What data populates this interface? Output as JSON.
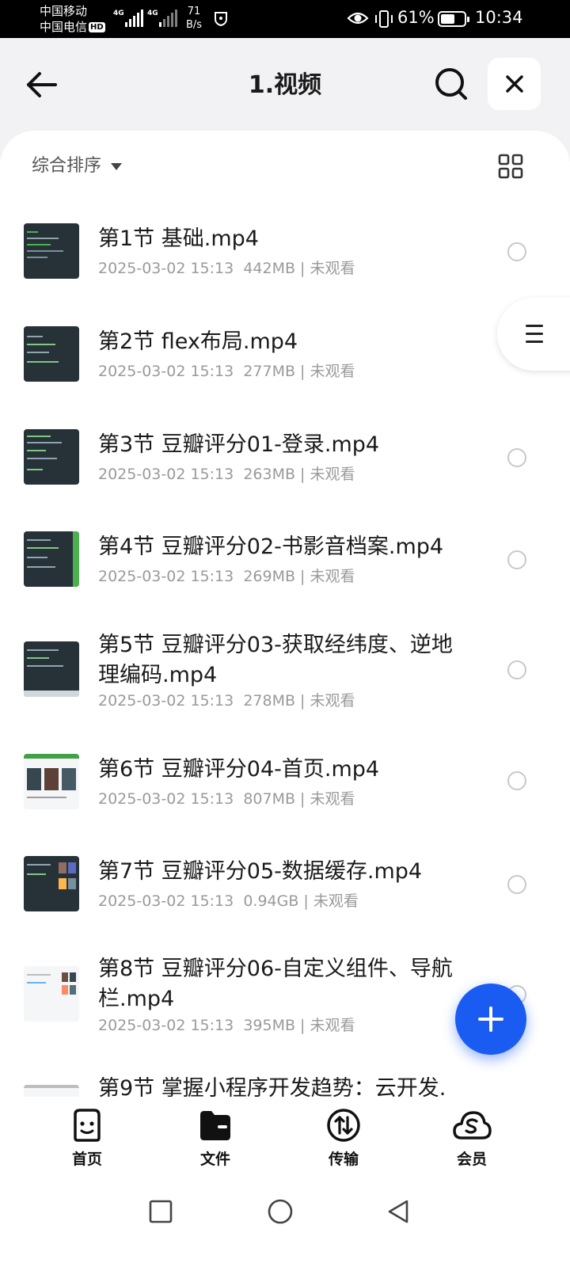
{
  "status_bar": {
    "carrier1": "中国移动",
    "carrier2": "中国电信",
    "hd": "HD",
    "net_speed_value": "71",
    "net_speed_unit": "B/s",
    "battery_percent": "61%",
    "battery_level": 0.61,
    "time": "10:34"
  },
  "header": {
    "title": "1.视频"
  },
  "toolbar": {
    "sort_label": "综合排序"
  },
  "files": [
    {
      "name": "第1节 基础.mp4",
      "date": "2025-03-02 15:13",
      "size": "442MB",
      "status": "未观看"
    },
    {
      "name": "第2节 flex布局.mp4",
      "date": "2025-03-02 15:13",
      "size": "277MB",
      "status": "未观看"
    },
    {
      "name": "第3节 豆瓣评分01-登录.mp4",
      "date": "2025-03-02 15:13",
      "size": "263MB",
      "status": "未观看"
    },
    {
      "name": "第4节 豆瓣评分02-书影音档案.mp4",
      "date": "2025-03-02 15:13",
      "size": "269MB",
      "status": "未观看"
    },
    {
      "name": "第5节 豆瓣评分03-获取经纬度、逆地理编码.mp4",
      "date": "2025-03-02 15:13",
      "size": "278MB",
      "status": "未观看"
    },
    {
      "name": "第6节 豆瓣评分04-首页.mp4",
      "date": "2025-03-02 15:13",
      "size": "807MB",
      "status": "未观看"
    },
    {
      "name": "第7节 豆瓣评分05-数据缓存.mp4",
      "date": "2025-03-02 15:13",
      "size": "0.94GB",
      "status": "未观看"
    },
    {
      "name": "第8节 豆瓣评分06-自定义组件、导航栏.mp4",
      "date": "2025-03-02 15:13",
      "size": "395MB",
      "status": "未观看"
    },
    {
      "name": "第9节 掌握小程序开发趋势：云开发.",
      "date": "",
      "size": "",
      "status": ""
    }
  ],
  "tabs": [
    {
      "label": "首页",
      "icon": "smiley-icon"
    },
    {
      "label": "文件",
      "icon": "folder-icon"
    },
    {
      "label": "传输",
      "icon": "transfer-icon"
    },
    {
      "label": "会员",
      "icon": "cloud-s-icon"
    }
  ],
  "colors": {
    "accent": "#1a5cf2",
    "background": "#f2f2f4",
    "meta_text": "#9a9a9a"
  }
}
